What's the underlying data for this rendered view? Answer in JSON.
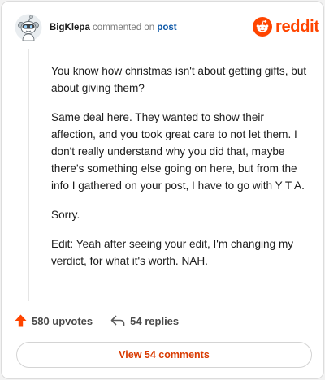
{
  "header": {
    "username": "BigKlepa",
    "action": "commented on",
    "target": "post"
  },
  "brand": {
    "wordmark": "reddit",
    "color": "#ff4500"
  },
  "comment": {
    "paragraphs": [
      "You know how christmas isn't about getting gifts, but about giving them?",
      "Same deal here. They wanted to show their affection, and you took great care to not let them. I don't really understand why you did that, maybe there's something else going on here, but from the info I gathered on your post, I have to go with Y T A.",
      "Sorry.",
      "Edit: Yeah after seeing your edit, I'm changing my verdict, for what it's worth. NAH."
    ]
  },
  "stats": {
    "upvotes": "580 upvotes",
    "replies": "54 replies"
  },
  "footer": {
    "view_comments_label": "View 54 comments"
  },
  "icons": {
    "avatar": "snoo-avatar-icon",
    "logo": "reddit-logo-icon",
    "upvote": "upvote-arrow-icon",
    "reply": "reply-arrow-icon"
  }
}
